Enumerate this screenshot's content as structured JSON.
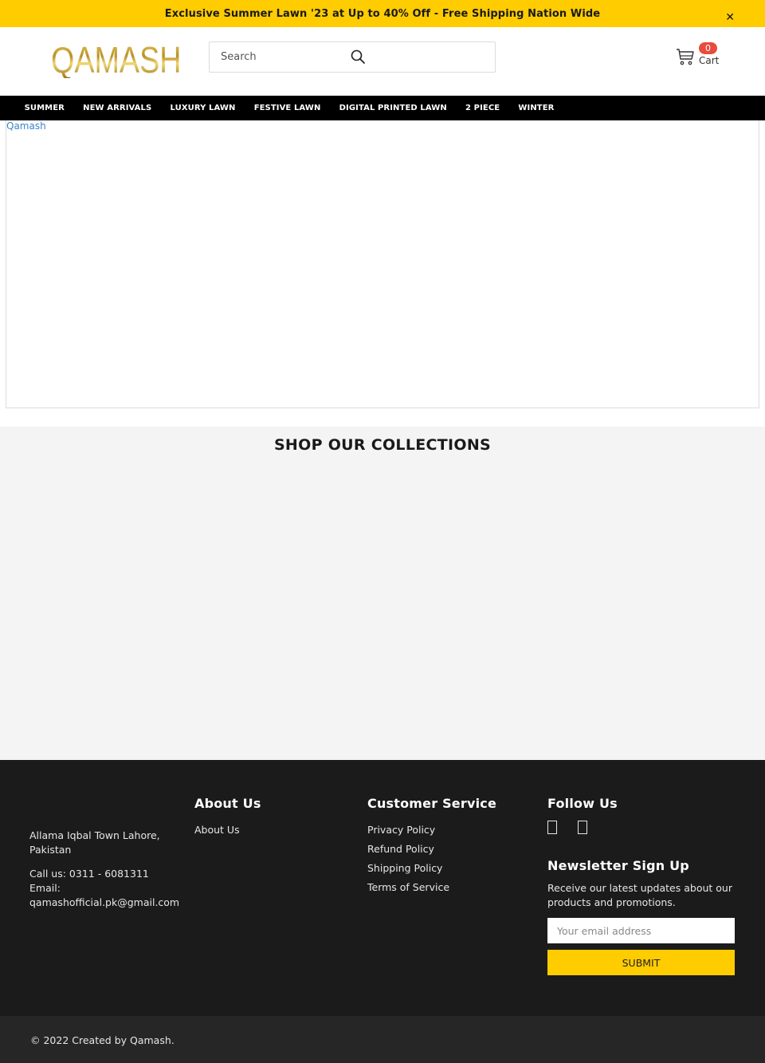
{
  "announcement": {
    "text": "Exclusive Summer Lawn '23 at Up to 40% Off - Free Shipping Nation Wide",
    "close_icon": "close-icon",
    "close_glyph": "✕"
  },
  "header": {
    "logo": "QAMASH",
    "search": {
      "placeholder": "Search",
      "value": "",
      "icon": "search-icon"
    },
    "cart": {
      "count": "0",
      "label": "Cart",
      "icon": "cart-icon"
    }
  },
  "nav": {
    "items": [
      {
        "label": "SUMMER"
      },
      {
        "label": "NEW ARRIVALS"
      },
      {
        "label": "LUXURY LAWN"
      },
      {
        "label": "FESTIVE LAWN"
      },
      {
        "label": "DIGITAL PRINTED LAWN"
      },
      {
        "label": "2 PIECE"
      },
      {
        "label": "WINTER"
      }
    ]
  },
  "hero": {
    "link_text": "Qamash"
  },
  "collections": {
    "title": "SHOP OUR COLLECTIONS"
  },
  "footer": {
    "contact": {
      "address": "Allama Iqbal Town Lahore, Pakistan",
      "phone": "Call us: 0311 - 6081311",
      "email_label": "Email:",
      "email": "qamashofficial.pk@gmail.com"
    },
    "about": {
      "heading": "About Us",
      "links": [
        "About Us"
      ]
    },
    "customer_service": {
      "heading": "Customer Service",
      "links": [
        "Privacy Policy",
        "Refund Policy",
        "Shipping Policy",
        "Terms of Service"
      ]
    },
    "follow": {
      "heading": "Follow Us",
      "icons": [
        "facebook-icon",
        "instagram-icon"
      ]
    },
    "newsletter": {
      "heading": "Newsletter Sign Up",
      "description": "Receive our latest updates about our products and promotions.",
      "email_placeholder": "Your email address",
      "submit_label": "SUBMIT"
    }
  },
  "bottom": {
    "copyright": "© 2022 Created by Qamash."
  },
  "colors": {
    "accent_yellow": "#ffcc00",
    "nav_bg": "#000000",
    "footer_bg": "#1b1b1b",
    "bottom_bg": "#262626",
    "badge_red": "#e74c3c",
    "link_blue": "#3a86c8"
  }
}
